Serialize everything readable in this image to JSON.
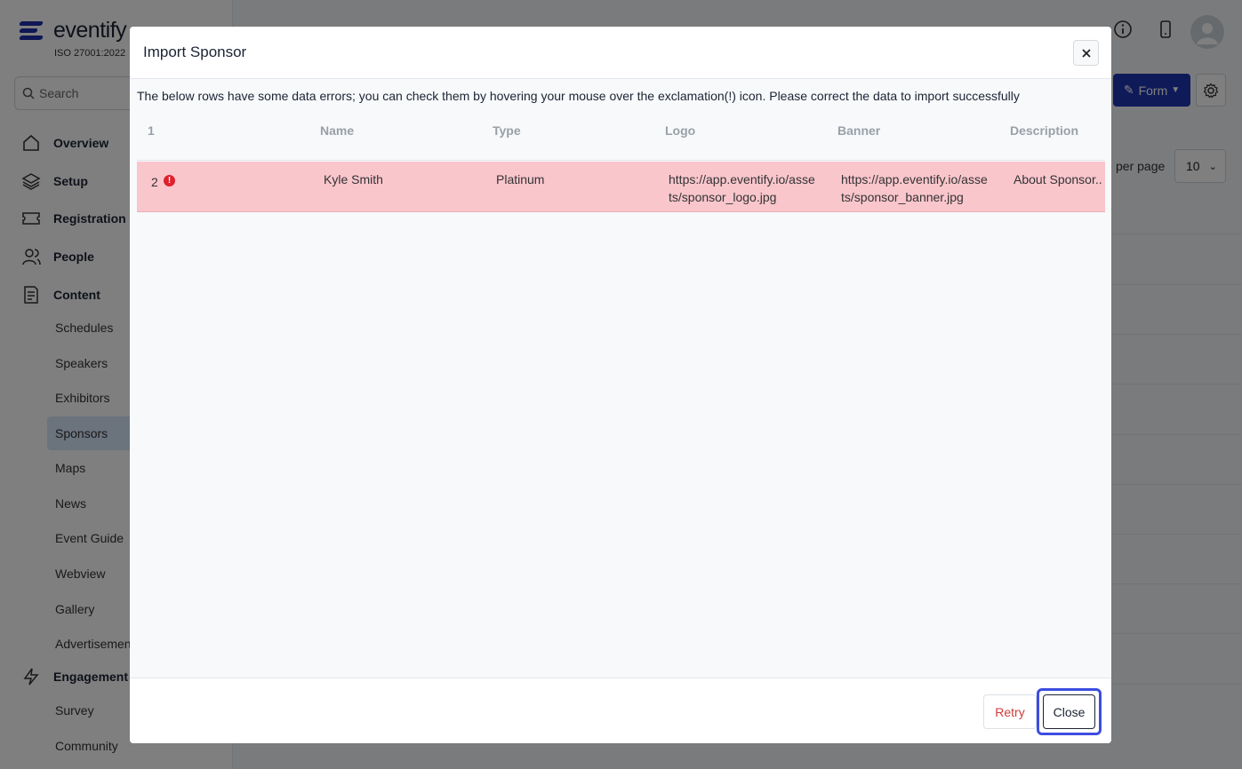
{
  "app": {
    "logo_text": "eventify",
    "iso_label": "ISO 27001:2022",
    "search_placeholder": "Search"
  },
  "sidebar": {
    "groups": [
      {
        "label": "Overview",
        "icon": "home-icon"
      },
      {
        "label": "Setup",
        "icon": "layers-icon"
      },
      {
        "label": "Registration",
        "icon": "ticket-icon"
      },
      {
        "label": "People",
        "icon": "people-icon"
      },
      {
        "label": "Content",
        "icon": "document-icon"
      },
      {
        "label": "Engagement",
        "icon": "lightning-icon"
      }
    ],
    "content_items": [
      "Schedules",
      "Speakers",
      "Exhibitors",
      "Sponsors",
      "Maps",
      "News",
      "Event Guide",
      "Webview",
      "Gallery",
      "Advertisement"
    ],
    "engagement_items": [
      "Survey",
      "Community"
    ],
    "active_item": "Sponsors"
  },
  "toolbar": {
    "form_label": "Form",
    "per_page_label": "per page",
    "per_page_value": "10"
  },
  "modal": {
    "title": "Import Sponsor",
    "note": "The below rows have some data errors; you can check them by hovering your mouse over the exclamation(!) icon. Please correct the data to import successfully",
    "columns": [
      "1",
      "Name",
      "Type",
      "Logo",
      "Banner",
      "Description"
    ],
    "rows": [
      {
        "row_number": "2",
        "name": "Kyle Smith",
        "type": "Platinum",
        "logo": "https://app.eventify.io/assets/sponsor_logo.jpg",
        "banner": "https://app.eventify.io/assets/sponsor_banner.jpg",
        "description": "About Sponsor.."
      }
    ],
    "retry_label": "Retry",
    "close_label": "Close"
  },
  "colors": {
    "accent": "#1f35b0",
    "error_row": "#f9c6cc",
    "error_icon": "#e0202e",
    "focus_ring": "#3d4de0"
  }
}
